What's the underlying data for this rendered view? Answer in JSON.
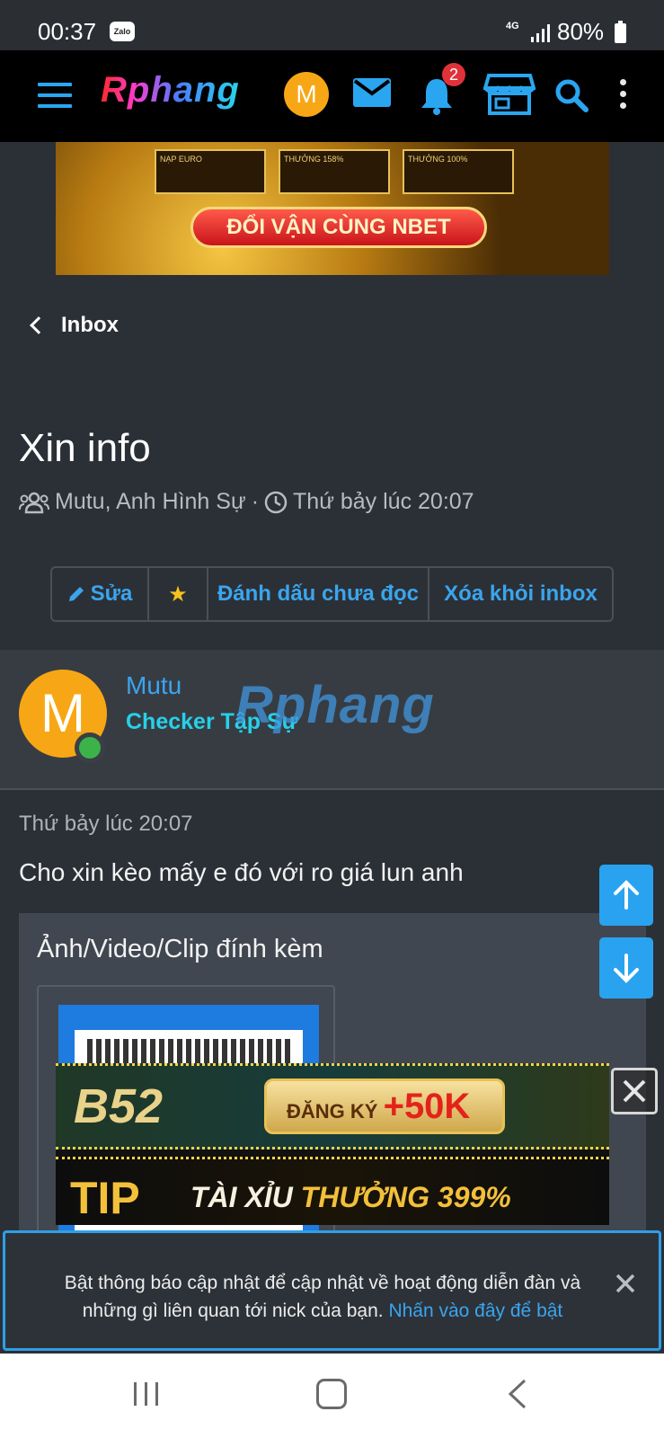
{
  "status_bar": {
    "time": "00:37",
    "app_icon_label": "Zalo",
    "network": "4G",
    "battery": "80%"
  },
  "nav": {
    "logo": "Rphang",
    "avatar_letter": "M",
    "notification_count": "2",
    "icons": [
      "menu-icon",
      "mail-icon",
      "bell-icon",
      "store-icon",
      "search-icon",
      "more-vertical-icon"
    ],
    "accent_color": "#2aa6f0"
  },
  "ad_top": {
    "cta": "ĐỔI VẬN CÙNG NBET",
    "cards": [
      "NẠP EURO",
      "THƯỞNG 158%",
      "THƯỞNG 100%"
    ]
  },
  "back": {
    "label": "Inbox"
  },
  "conversation": {
    "title": "Xin info",
    "participants": "Mutu, Anh Hình Sự",
    "separator": "·",
    "date": "Thứ bảy lúc 20:07"
  },
  "actions": {
    "edit": "Sửa",
    "star": "★",
    "mark_unread": "Đánh dấu chưa đọc",
    "remove_inbox": "Xóa khỏi inbox"
  },
  "message": {
    "avatar_letter": "M",
    "author": "Mutu",
    "author_title": "Checker Tập Sự",
    "watermark": "Rphang",
    "date": "Thứ bảy lúc 20:07",
    "text": "Cho xin kèo mấy e đó với ro giá lun anh",
    "attachments_title": "Ảnh/Video/Clip đính kèm"
  },
  "ad_bottom": {
    "b52_logo": "B52",
    "b52_cta_text": "ĐĂNG KÝ",
    "b52_cta_amount": "+50K",
    "tip_logo": "TIP",
    "tip_text": "TÀI XỈU",
    "tip_bonus": "THƯỞNG 399%"
  },
  "notice": {
    "text": "Bật thông báo cập nhật để cập nhật về hoạt động diễn đàn và những gì liên quan tới nick của bạn.",
    "link": "Nhấn vào đây để bật"
  }
}
